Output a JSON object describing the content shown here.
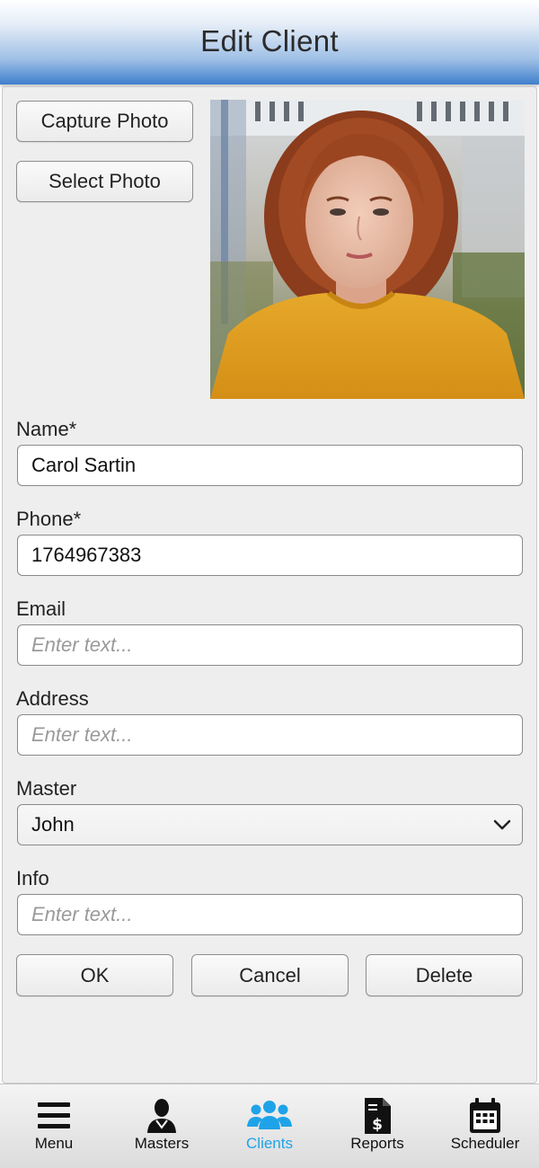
{
  "header": {
    "title": "Edit Client"
  },
  "photo_actions": {
    "capture_label": "Capture Photo",
    "select_label": "Select Photo"
  },
  "form": {
    "name": {
      "label": "Name*",
      "value": "Carol Sartin"
    },
    "phone": {
      "label": "Phone*",
      "value": "1764967383"
    },
    "email": {
      "label": "Email",
      "placeholder": "Enter text..."
    },
    "address": {
      "label": "Address",
      "placeholder": "Enter text..."
    },
    "master": {
      "label": "Master",
      "value": "John"
    },
    "info": {
      "label": "Info",
      "placeholder": "Enter text..."
    }
  },
  "actions": {
    "ok": "OK",
    "cancel": "Cancel",
    "delete": "Delete"
  },
  "tabbar": {
    "items": [
      {
        "label": "Menu",
        "icon": "menu-icon"
      },
      {
        "label": "Masters",
        "icon": "person-icon"
      },
      {
        "label": "Clients",
        "icon": "group-icon",
        "active": true
      },
      {
        "label": "Reports",
        "icon": "invoice-icon"
      },
      {
        "label": "Scheduler",
        "icon": "calendar-icon"
      }
    ],
    "active_color": "#1fa3e8"
  }
}
